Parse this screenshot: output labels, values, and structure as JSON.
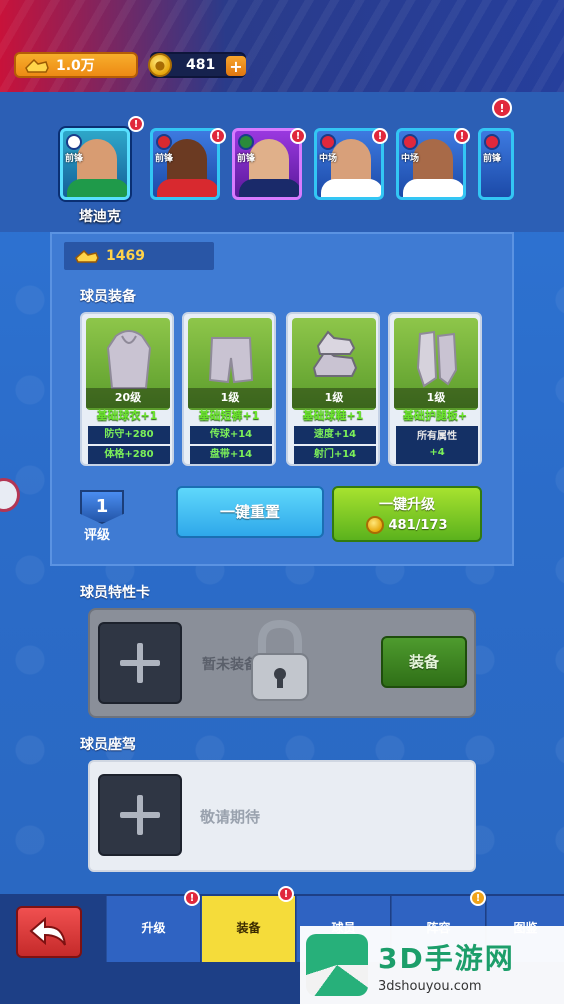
{
  "header": {
    "boots_amount": "1.0万",
    "coins_amount": "481",
    "plus_symbol": "+",
    "notice_symbol": "!"
  },
  "players": [
    {
      "position": "前锋",
      "selected": true
    },
    {
      "position": "前锋",
      "selected": false
    },
    {
      "position": "前锋",
      "selected": false
    },
    {
      "position": "中场",
      "selected": false
    },
    {
      "position": "中场",
      "selected": false
    },
    {
      "position": "前锋",
      "selected": false
    }
  ],
  "selected_player_name": "塔迪克",
  "panel": {
    "boots_score": "1469",
    "equipment_title": "球员装备",
    "equipment": [
      {
        "level": "20级",
        "name": "基础球衣+1",
        "stats": [
          "防守+280",
          "体格+280"
        ]
      },
      {
        "level": "1级",
        "name": "基础短裤+1",
        "stats": [
          "传球+14",
          "盘带+14"
        ]
      },
      {
        "level": "1级",
        "name": "基础球鞋+1",
        "stats": [
          "速度+14",
          "射门+14"
        ]
      },
      {
        "level": "1级",
        "name": "基础护腿板+",
        "stats": [
          "所有属性",
          "+4"
        ]
      }
    ],
    "rank_value": "1",
    "rank_label": "评级",
    "reset_button": "一键重置",
    "upgrade_button": "一键升级",
    "upgrade_cost": "481/173"
  },
  "trait": {
    "title": "球员特性卡",
    "empty_text": "暂未装备特性卡",
    "equip_button": "装备"
  },
  "seat": {
    "title": "球员座驾",
    "coming_soon": "敬请期待"
  },
  "bottom_nav": {
    "tabs": [
      "升级",
      "装备",
      "球员",
      "阵容",
      "图鉴"
    ],
    "active": "装备"
  },
  "watermark": {
    "main": "3D手游网",
    "sub": "3dshouyou.com"
  },
  "colors": {
    "background": "#2a6fd1",
    "accent_green": "#5bb21d",
    "accent_cyan": "#2fa8ea",
    "alert_red": "#e0283c",
    "active_tab": "#f5dc3a"
  }
}
